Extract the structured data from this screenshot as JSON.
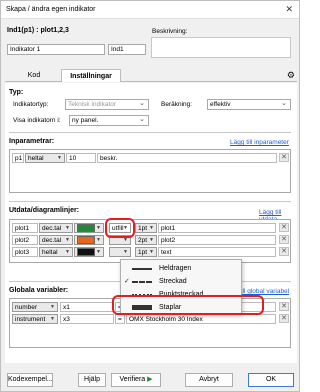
{
  "window": {
    "title": "Skapa / ändra egen indikator",
    "close": "✕"
  },
  "header": {
    "indicator_heading": "Ind1(p1) : plot1,2,3",
    "name_value": "Indikator 1",
    "short_value": "Ind1",
    "description_label": "Beskrivning:"
  },
  "tabs": [
    {
      "label": "Kod"
    },
    {
      "label": "Inställningar"
    }
  ],
  "type_section": {
    "heading": "Typ:",
    "indicator_type_label": "Indikatortyp:",
    "indicator_type_value": "Teknisk indikator",
    "calc_label": "Beräkning:",
    "calc_value": "effektiv",
    "show_in_label": "Visa indikatorn i:",
    "show_in_value": "ny panel."
  },
  "params": {
    "heading": "Inparametrar:",
    "add_link": "Lägg till inparameter",
    "rows": [
      {
        "name": "p1",
        "type": "heltal",
        "value": "10",
        "desc": "beskr."
      }
    ]
  },
  "outputs": {
    "heading": "Utdata/diagramlinjer:",
    "add_link": "Lägg till utdata",
    "rows": [
      {
        "name": "plot1",
        "type": "dec.tal",
        "color": "#1f8a3a",
        "style": "utfill",
        "width": "1pt",
        "label": "plot1"
      },
      {
        "name": "plot2",
        "type": "dec.tal",
        "color": "#e8661c",
        "style": "",
        "width": "2pt",
        "label": "plot2"
      },
      {
        "name": "plot3",
        "type": "heltal",
        "color": "#111111",
        "style": "",
        "width": "1pt",
        "label": "text"
      }
    ]
  },
  "style_menu": {
    "items": [
      {
        "label": "Heldragen",
        "icon": "solid-line-icon",
        "checked": false
      },
      {
        "label": "Streckad",
        "icon": "dashed-line-icon",
        "checked": true
      },
      {
        "label": "Punktstreckad",
        "icon": "dotted-line-icon",
        "checked": false
      },
      {
        "label": "Staplar",
        "icon": "bar-icon",
        "checked": false
      }
    ]
  },
  "globals": {
    "heading": "Globala variabler:",
    "add_link": "Lägg till global variabel",
    "rows": [
      {
        "type": "number",
        "name": "x1",
        "eq": "=",
        "value": ""
      },
      {
        "type": "instrument",
        "name": "x3",
        "eq": "=",
        "value": "OMX Stockholm 30 Index"
      }
    ]
  },
  "buttons": {
    "examples": "Kodexempel...",
    "help": "Hjälp",
    "verify": "Verifiera",
    "cancel": "Avbryt",
    "ok": "OK"
  }
}
